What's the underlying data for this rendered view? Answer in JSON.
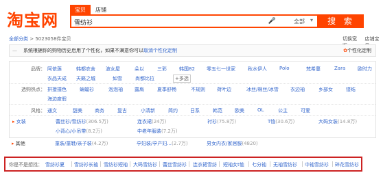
{
  "header": {
    "logo": "淘宝网",
    "tabs": [
      "宝贝",
      "店铺"
    ],
    "search_query": "雪纺衫",
    "scope": "全部",
    "scope_arrow": "▾",
    "search_button": "搜 索",
    "suggest_text": ""
  },
  "breadcrumb": {
    "root": "全部分类",
    "sep": ">",
    "count_text": "5023058件宝贝"
  },
  "tools": [
    "切换宽版",
    "店铺宝贝"
  ],
  "notice": {
    "icon": "—",
    "text": "系统根据你的购物历史启用了个性化，如果不满意你可以",
    "link": "取消个性化定制",
    "right_icon": "✿",
    "right": "个性化定制"
  },
  "filters": [
    {
      "label": "品牌：",
      "values": [
        "阿依莲",
        "韩都衣舍",
        "波女屋",
        "朵以",
        "三彩",
        "韩国82",
        "零五七一世家",
        "秋水伊人",
        "Polo",
        "梵希蔓",
        "Zara",
        "欧时力",
        "衣品天成",
        "天籁之城",
        "如雪",
        "尚都比拉",
        "+多选"
      ]
    },
    {
      "label": "选购热点：",
      "values": [
        "拼接撞色",
        "蝙蝠衫",
        "泡泡袖",
        "露肩",
        "夏季舒畅",
        "不规则",
        "荷叶边",
        "冰丝/棉丝/冰雪",
        "衣边袖",
        "乡部女",
        "镂结",
        "海边度假"
      ]
    },
    {
      "label": "风格：",
      "values": [
        "通文",
        "甜美",
        "商务",
        "复古",
        "小清新",
        "简约",
        "日系",
        "韩范",
        "欧美",
        "OL",
        "公主",
        "可爱"
      ]
    }
  ],
  "categories": {
    "row1_label": "女装",
    "row1": [
      {
        "name": "蕾丝衫/雪纺衫",
        "count": "(306.5万)"
      },
      {
        "name": "连衣裙",
        "count": "(24万)"
      },
      {
        "name": "衬衫",
        "count": "(75.8万)"
      },
      {
        "name": "T恤",
        "count": "(30.6万)"
      },
      {
        "name": "大码女装",
        "count": "(14.8万)"
      }
    ],
    "row1b": [
      {
        "name": "小背心/小吊带",
        "count": "(8.2万)"
      },
      {
        "name": "中老年服装",
        "count": "(7.2万)"
      }
    ],
    "row2_label": "其他",
    "row2": [
      {
        "name": "童装/童鞋/亲子装",
        "count": "(4.2万)"
      },
      {
        "name": "孕妇装/孕产妇...",
        "count": "(2.7万)"
      },
      {
        "name": "男女内衣/家居服",
        "count": "(4820)"
      }
    ]
  },
  "related": {
    "label": "你是不是想找：",
    "items": [
      "雪纺衫夏",
      "雪纺衫长袖",
      "雪纺衫短袖",
      "大码雪纺衫",
      "蕾丝雪纺衫",
      "连衣裙雪纺",
      "短袖女t恤",
      "七分袖",
      "无袖雪纺衫",
      "中袖雪纺衫",
      "碎花雪纺衫"
    ]
  }
}
